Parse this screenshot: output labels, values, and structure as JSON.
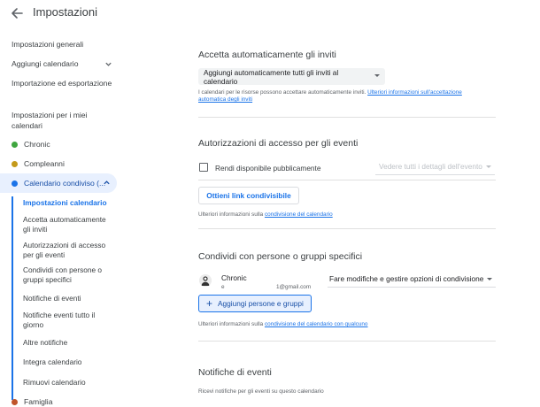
{
  "header": {
    "title": "Impostazioni"
  },
  "sidebar": {
    "items": [
      {
        "label": "Impostazioni generali"
      },
      {
        "label": "Aggiungi calendario"
      },
      {
        "label": "Importazione ed esportazione"
      }
    ],
    "section_title": "Impostazioni per i miei calendari",
    "calendars": [
      {
        "label": "Chronic",
        "color": "#3fa63f"
      },
      {
        "label": "Compleanni",
        "color": "#c49a1a"
      },
      {
        "label": "Calendario condiviso (...",
        "color": "#1a73e8"
      }
    ],
    "sub_items": [
      {
        "label": "Impostazioni calendario"
      },
      {
        "label": "Accetta automaticamente gli inviti"
      },
      {
        "label": "Autorizzazioni di accesso per gli eventi"
      },
      {
        "label": "Condividi con persone o gruppi specifici"
      },
      {
        "label": "Notifiche di eventi"
      },
      {
        "label": "Notifiche eventi tutto il giorno"
      },
      {
        "label": "Altre notifiche"
      },
      {
        "label": "Integra calendario"
      },
      {
        "label": "Rimuovi calendario"
      }
    ],
    "last_calendar": {
      "label": "Famiglia",
      "color": "#c0552a"
    }
  },
  "main": {
    "accept": {
      "title": "Accetta automaticamente gli inviti",
      "select_value": "Aggiungi automaticamente tutti gli inviti al calendario",
      "note_text": "I calendari per le risorse possono accettare automaticamente inviti.",
      "note_link": "Ulteriori informazioni sull'accettazione automatica degli inviti"
    },
    "access": {
      "title": "Autorizzazioni di accesso per gli eventi",
      "checkbox_label": "Rendi disponibile pubblicamente",
      "disabled_select": "Vedere tutti i dettagli dell'evento",
      "button_label": "Ottieni link condivisibile",
      "note_text": "Ulteriori informazioni sulla",
      "note_link": "condivisione del calendario"
    },
    "share": {
      "title": "Condividi con persone o gruppi specifici",
      "person_name": "Chronic",
      "person_email_a": "e",
      "person_email_b": "1@gmail.com",
      "permission": "Fare modifiche e gestire opzioni di condivisione",
      "add_button": "Aggiungi persone e gruppi",
      "add_icon": "+",
      "note_text": "Ulteriori informazioni sulla",
      "note_link": "condivisione del calendario con qualcuno"
    },
    "notifications": {
      "title": "Notifiche di eventi",
      "note_text": "Ricevi notifiche per gli eventi su questo calendario"
    }
  }
}
